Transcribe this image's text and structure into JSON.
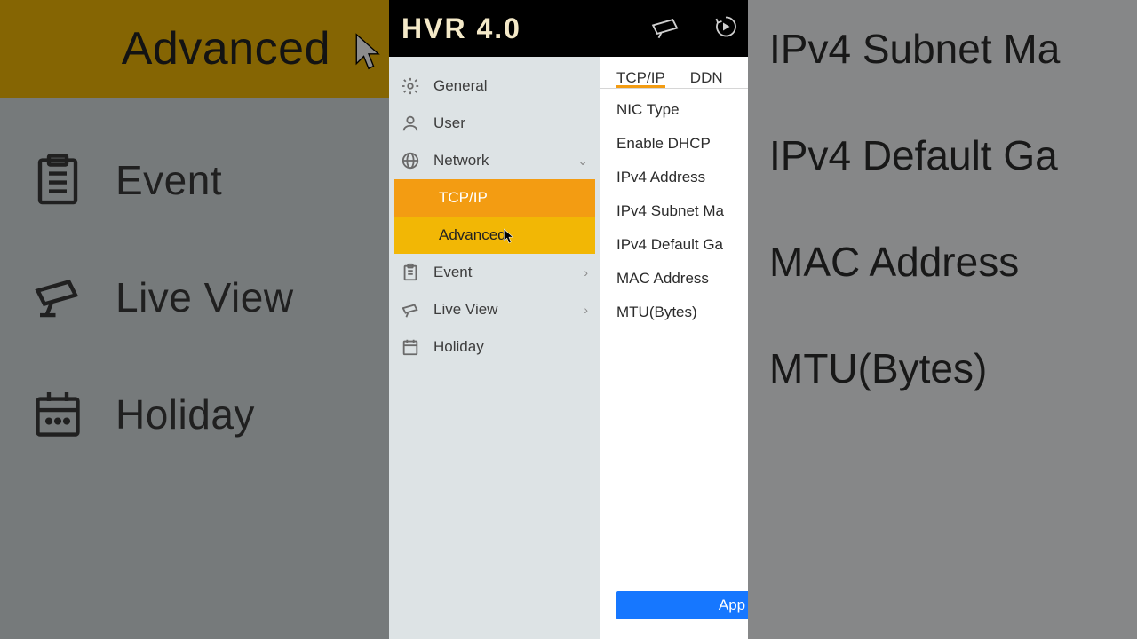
{
  "bg_left": {
    "advanced": "Advanced",
    "event": "Event",
    "live_view": "Live View",
    "holiday": "Holiday"
  },
  "bg_right": {
    "subnet": "IPv4 Subnet Ma",
    "gateway": "IPv4 Default Ga",
    "mac": "MAC Address",
    "mtu": "MTU(Bytes)"
  },
  "titlebar": {
    "brand": "HVR 4.0"
  },
  "sidebar": {
    "general": "General",
    "user": "User",
    "network": "Network",
    "tcpip": "TCP/IP",
    "advanced": "Advanced",
    "event": "Event",
    "live_view": "Live View",
    "holiday": "Holiday"
  },
  "tabs": {
    "tcpip": "TCP/IP",
    "ddns": "DDN"
  },
  "labels": {
    "nic": "NIC Type",
    "dhcp": "Enable DHCP",
    "ipv4": "IPv4 Address",
    "subnet": "IPv4 Subnet Ma",
    "gateway": "IPv4 Default Ga",
    "mac": "MAC Address",
    "mtu": "MTU(Bytes)"
  },
  "buttons": {
    "apply": "App"
  }
}
